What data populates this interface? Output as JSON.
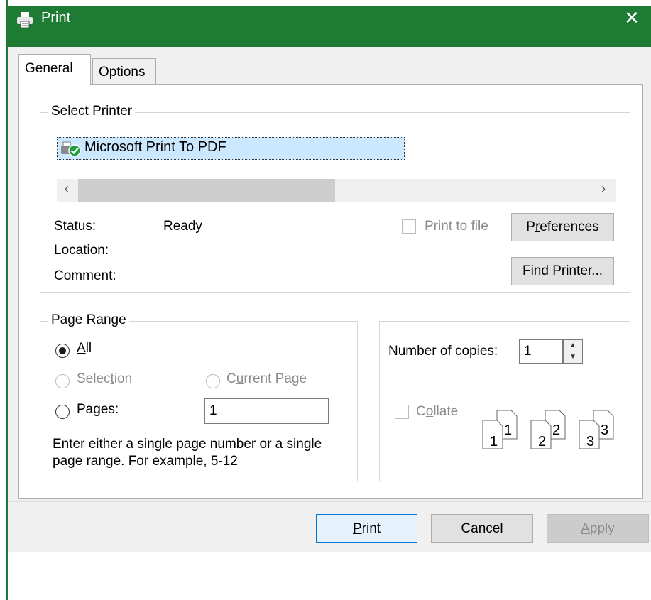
{
  "window": {
    "title": "Print",
    "close_glyph": "✕",
    "accent_color": "#1e7b34"
  },
  "tabs": [
    {
      "label": "General",
      "selected": true
    },
    {
      "label": "Options",
      "selected": false
    }
  ],
  "select_printer": {
    "legend": "Select Printer",
    "printers": [
      {
        "name": "Microsoft Print To PDF",
        "icon": "printer-default-icon",
        "selected": true
      }
    ],
    "scroll_left": "‹",
    "scroll_right": "›",
    "status_label": "Status:",
    "status_value": "Ready",
    "location_label": "Location:",
    "comment_label": "Comment:",
    "print_to_file": {
      "label_pre": "Print to ",
      "label_key": "f",
      "label_post": "ile",
      "checked": false,
      "enabled": false
    },
    "preferences_button": {
      "label_pre": "P",
      "label_key": "r",
      "label_post": "eferences"
    },
    "find_printer_button": {
      "label_pre": "Fin",
      "label_key": "d",
      "label_post": " Printer..."
    }
  },
  "page_range": {
    "legend": "Page Range",
    "all": {
      "label_pre": "",
      "label_key": "A",
      "label_post": "ll",
      "selected": true
    },
    "selection": {
      "label_pre": "Selec",
      "label_key": "t",
      "label_post": "ion",
      "enabled": false
    },
    "current_page": {
      "label_pre": "C",
      "label_key": "u",
      "label_post": "rrent Page",
      "enabled": false
    },
    "pages": {
      "label_pre": "Pa",
      "label_key": "g",
      "label_post": "es:",
      "value": "1"
    },
    "hint": "Enter either a single page number or a single page range.  For example, 5-12"
  },
  "copies": {
    "label_pre": "Number of ",
    "label_key": "c",
    "label_post": "opies:",
    "value": "1",
    "collate": {
      "label_pre": "C",
      "label_key": "o",
      "label_post": "llate",
      "checked": false,
      "enabled": false
    },
    "illustration_pages": [
      "1",
      "1",
      "2",
      "2",
      "3",
      "3"
    ]
  },
  "buttons": {
    "print": {
      "label_pre": "",
      "label_key": "P",
      "label_post": "rint"
    },
    "cancel": "Cancel",
    "apply": {
      "label_pre": "",
      "label_key": "A",
      "label_post": "pply",
      "enabled": false
    }
  }
}
